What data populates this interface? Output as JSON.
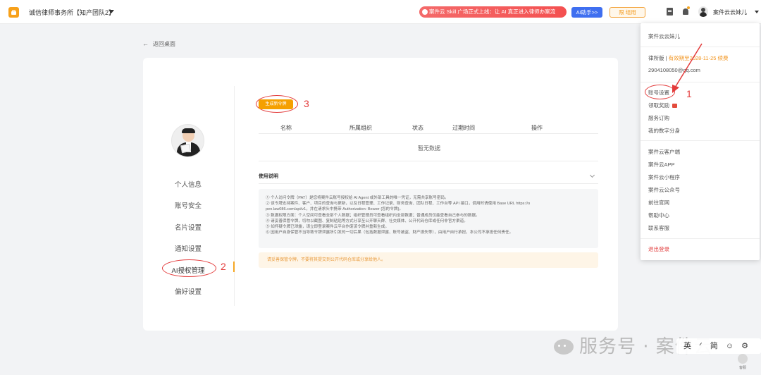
{
  "header": {
    "firm_name": "诚信律师事务所【知产团队2】",
    "promo_text": "案件云 Skill 广场正式上线：让 AI 真正进入律师办案流",
    "ai_button": "AI助手>>",
    "trial_button": "限 组用",
    "user_name": "案件云云妹儿"
  },
  "back_link": "返回桌面",
  "side_nav": {
    "items": [
      "个人信息",
      "账号安全",
      "名片设置",
      "通知设置",
      "AI授权管理",
      "偏好设置"
    ],
    "active": "AI授权管理"
  },
  "content": {
    "generate_button": "生成新令牌",
    "table_headers": [
      "名称",
      "所属组织",
      "状态",
      "过期时间",
      "操作"
    ],
    "empty_text": "暂无数据",
    "usage_title": "使用说明",
    "usage_notes": [
      "① 个人访问令牌（PAT）是您将案件云账号授权给 AI Agent 或外部工具的唯一凭证，无需共享账号密码。",
      "② 该令牌支持案件、客户、项目的查询与更新，以及日程管理、工作记录、财务查询、团队日程、工作台等 API 接口，调用时请使用 Base URL https://o",
      "pen.law086.com/api/v1，并在请求头中携带 Authorization: Bearer {您的令牌}。",
      "③ 数据权限方面：个人空间可查看全部个人数据；组织管理员可查看组织内全部数据；普通成员仅能查看自己参与的数据。",
      "④ 请妥善保管令牌，切勿以截图、复制粘贴等方式分享至公开聊天群、社交媒体、公开代码仓库或任何非官方渠道。",
      "⑤ 如怀疑令牌已泄露，请立即登录案件云平台作废该令牌并重新生成。",
      "⑥ 因用户自身保管不当导致令牌泄露所引发的一切后果（包括数据泄露、账号被盗、财产损失等），由用户自行承担，本公司不承担任何责任。"
    ],
    "warning_text": "请妥善保管令牌，不要将其提交到公开代码仓库或分享给他人。"
  },
  "annotations": [
    "1",
    "2",
    "3"
  ],
  "dropdown": {
    "name": "案件云云妹儿",
    "edition_label": "律所版 | ",
    "edition_expiry": "有效期至2028-11-25 续费",
    "email": "2904108050@qq.com",
    "group1": [
      "账号设置",
      "领取奖励",
      "服务订购",
      "我的数字分身"
    ],
    "group2": [
      "案件云客户端",
      "案件云APP",
      "案件云小程序",
      "案件云公众号",
      "前往官网",
      "帮助中心",
      "联系客服"
    ],
    "logout": "退出登录"
  },
  "watermark": "服务号 · 案件云",
  "ime": "英 ᐟ 简 ☺ ⚙",
  "help_widget_label": "客服",
  "colors": {
    "accent": "#f5a000",
    "annotation": "#e33b3b",
    "primary": "#3f6ff0",
    "promo": "#f45050"
  }
}
